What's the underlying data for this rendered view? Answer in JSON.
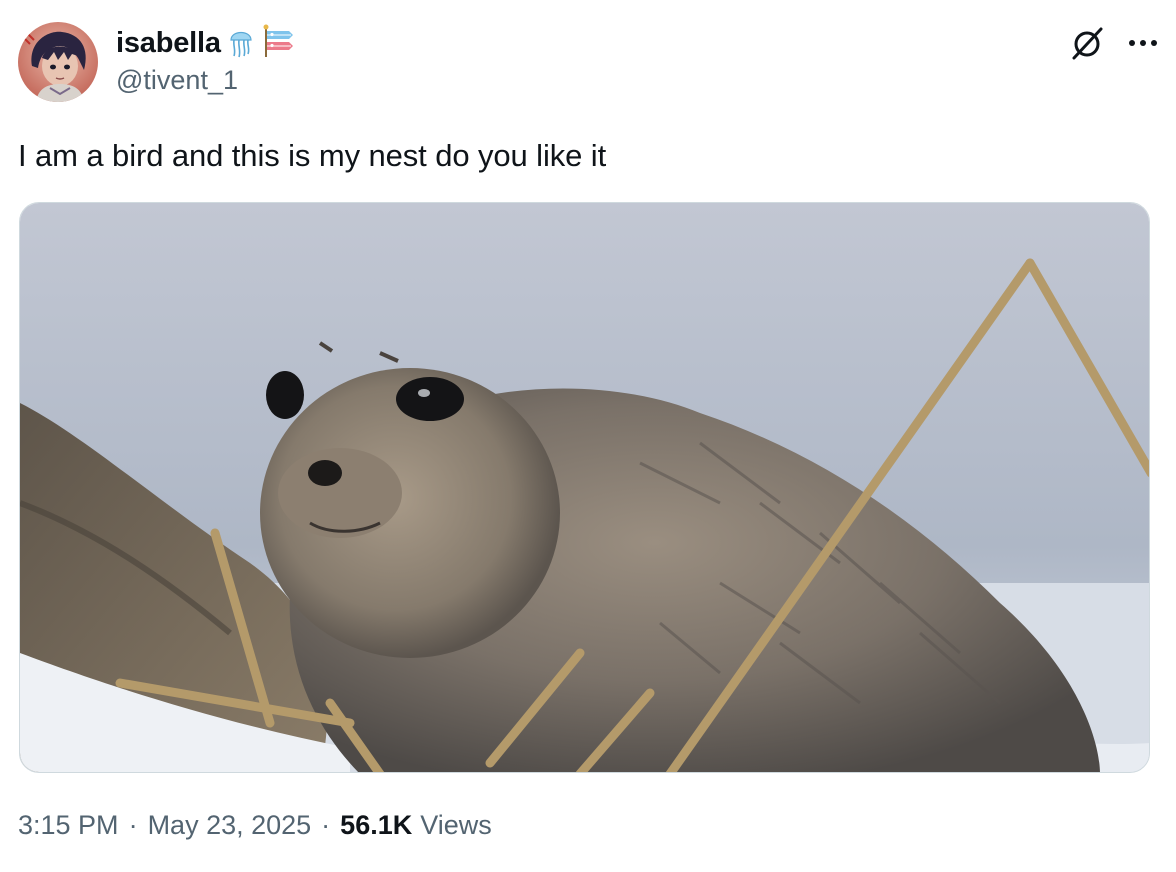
{
  "author": {
    "display_name": "isabella",
    "emojis": [
      "jellyfish",
      "carp-streamer"
    ],
    "handle": "@tivent_1"
  },
  "icons": {
    "grok": "grok-slash-circle-icon",
    "more": "more-dots-icon"
  },
  "tweet": {
    "text": "I am a bird and this is my nest do you like it"
  },
  "media": {
    "alt": "fluffy baby seal pup on snow"
  },
  "meta": {
    "time": "3:15 PM",
    "separator": "·",
    "date": "May 23, 2025",
    "views_count": "56.1K",
    "views_label": "Views"
  },
  "colors": {
    "text_primary": "#0f1419",
    "text_secondary": "#536471",
    "border": "#cfd9de"
  }
}
